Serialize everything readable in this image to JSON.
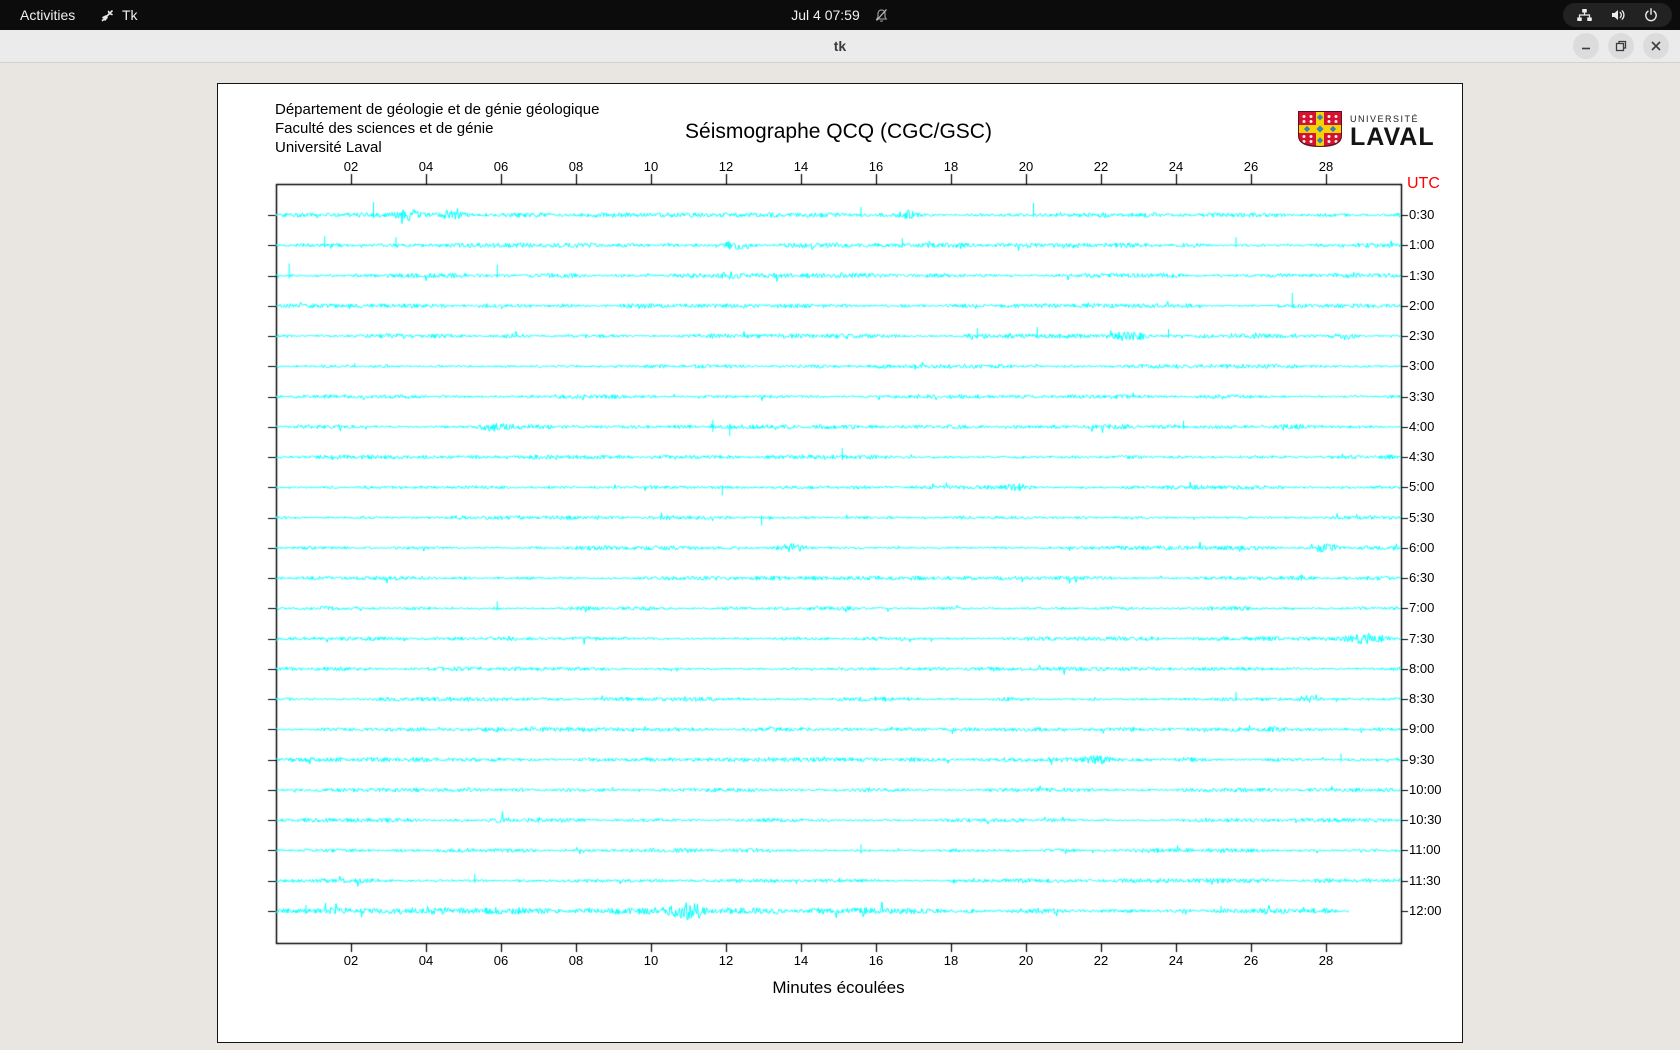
{
  "top_bar": {
    "activities_label": "Activities",
    "app_indicator_label": "Tk",
    "clock": "Jul 4 07:59",
    "tray_icons": [
      "network",
      "volume",
      "power"
    ]
  },
  "window": {
    "title": "tk",
    "controls": [
      "minimize",
      "maximize",
      "close"
    ]
  },
  "seismograph": {
    "header_lines": [
      "Département de géologie et de génie géologique",
      "Faculté des sciences et de génie",
      "Université Laval"
    ],
    "title": "Séismographe QCQ (CGC/GSC)",
    "utc_label": "UTC",
    "xlabel": "Minutes écoulées",
    "logo": {
      "line1": "UNIVERSITÉ",
      "line2": "LAVAL"
    },
    "colors": {
      "trace": "#00ffff",
      "utc_label": "#ff0000",
      "frame": "#000000"
    }
  },
  "chart_data": {
    "type": "line",
    "title": "Séismographe QCQ (CGC/GSC)",
    "xlabel": "Minutes écoulées",
    "x_range": [
      0,
      30
    ],
    "x_ticks": [
      "02",
      "04",
      "06",
      "08",
      "10",
      "12",
      "14",
      "16",
      "18",
      "20",
      "22",
      "24",
      "26",
      "28"
    ],
    "trace_color": "#00ffff",
    "rows": [
      {
        "label": "0:30",
        "base": 1.4,
        "spikes": [
          [
            2.6,
            13,
            3
          ],
          [
            15.6,
            8,
            2
          ],
          [
            20.2,
            12,
            2
          ]
        ],
        "bursts": [
          [
            3.6,
            0.25,
            4
          ],
          [
            4.65,
            0.3,
            4
          ],
          [
            16.8,
            0.15,
            3
          ]
        ]
      },
      {
        "label": "1:00",
        "base": 1.4,
        "spikes": [
          [
            1.3,
            9,
            2
          ],
          [
            3.2,
            8,
            2
          ],
          [
            16.7,
            7,
            2
          ],
          [
            25.6,
            8,
            2
          ]
        ],
        "bursts": [
          [
            12.2,
            0.2,
            3
          ]
        ]
      },
      {
        "label": "1:30",
        "base": 1.4,
        "spikes": [
          [
            0.35,
            12,
            3
          ],
          [
            5.9,
            11,
            2
          ]
        ],
        "bursts": [
          [
            12.1,
            0.15,
            2.5
          ]
        ]
      },
      {
        "label": "2:00",
        "base": 1.3,
        "spikes": [
          [
            27.1,
            13,
            2
          ]
        ],
        "bursts": []
      },
      {
        "label": "2:30",
        "base": 1.4,
        "spikes": [
          [
            18.7,
            8,
            2
          ],
          [
            20.3,
            9,
            2
          ],
          [
            23.8,
            7,
            2
          ]
        ],
        "bursts": [
          [
            22.8,
            0.3,
            4
          ],
          [
            28.5,
            0.2,
            3
          ]
        ]
      },
      {
        "label": "3:00",
        "base": 1.3,
        "spikes": [
          [
            2.1,
            3,
            1
          ]
        ],
        "bursts": []
      },
      {
        "label": "3:30",
        "base": 1.2,
        "spikes": [],
        "bursts": []
      },
      {
        "label": "4:00",
        "base": 1.4,
        "spikes": [
          [
            11.65,
            7,
            5
          ],
          [
            12.1,
            3,
            9
          ],
          [
            24.2,
            6,
            2
          ]
        ],
        "bursts": [
          [
            5.8,
            0.3,
            3.5
          ]
        ]
      },
      {
        "label": "4:30",
        "base": 1.3,
        "spikes": [
          [
            15.1,
            9,
            3
          ]
        ],
        "bursts": []
      },
      {
        "label": "5:00",
        "base": 1.3,
        "spikes": [
          [
            11.9,
            2,
            8
          ]
        ],
        "bursts": [
          [
            19.8,
            0.2,
            3.5
          ]
        ]
      },
      {
        "label": "5:30",
        "base": 1.2,
        "spikes": [
          [
            12.95,
            2,
            8
          ]
        ],
        "bursts": []
      },
      {
        "label": "6:00",
        "base": 1.3,
        "spikes": [],
        "bursts": [
          [
            13.8,
            0.25,
            3
          ],
          [
            28.0,
            0.2,
            3
          ]
        ]
      },
      {
        "label": "6:30",
        "base": 1.2,
        "spikes": [],
        "bursts": []
      },
      {
        "label": "7:00",
        "base": 1.3,
        "spikes": [
          [
            5.9,
            7,
            2
          ]
        ],
        "bursts": []
      },
      {
        "label": "7:30",
        "base": 1.3,
        "spikes": [],
        "bursts": [
          [
            29.0,
            0.35,
            5
          ]
        ]
      },
      {
        "label": "8:00",
        "base": 1.2,
        "spikes": [],
        "bursts": []
      },
      {
        "label": "8:30",
        "base": 1.3,
        "spikes": [
          [
            25.6,
            7,
            2
          ]
        ],
        "bursts": [
          [
            27.5,
            0.15,
            2.5
          ]
        ]
      },
      {
        "label": "9:00",
        "base": 1.2,
        "spikes": [],
        "bursts": [
          [
            26.7,
            0.15,
            3
          ]
        ]
      },
      {
        "label": "9:30",
        "base": 1.3,
        "spikes": [
          [
            28.4,
            6,
            2
          ]
        ],
        "bursts": [
          [
            21.9,
            0.2,
            3
          ]
        ]
      },
      {
        "label": "10:00",
        "base": 1.2,
        "spikes": [],
        "bursts": []
      },
      {
        "label": "10:30",
        "base": 1.2,
        "spikes": [],
        "bursts": [
          [
            6.0,
            0.2,
            2
          ]
        ]
      },
      {
        "label": "11:00",
        "base": 1.3,
        "spikes": [
          [
            15.6,
            6,
            3
          ]
        ],
        "bursts": []
      },
      {
        "label": "11:30",
        "base": 1.3,
        "spikes": [
          [
            5.3,
            7,
            2
          ]
        ],
        "bursts": [
          [
            25.0,
            0.15,
            2
          ]
        ]
      },
      {
        "label": "12:00",
        "base": 2.0,
        "spikes": [
          [
            0.8,
            6,
            3
          ],
          [
            25.2,
            5,
            2
          ]
        ],
        "bursts": [
          [
            10.9,
            0.3,
            4
          ],
          [
            11.15,
            0.2,
            4
          ]
        ],
        "end": 28.6
      }
    ]
  }
}
